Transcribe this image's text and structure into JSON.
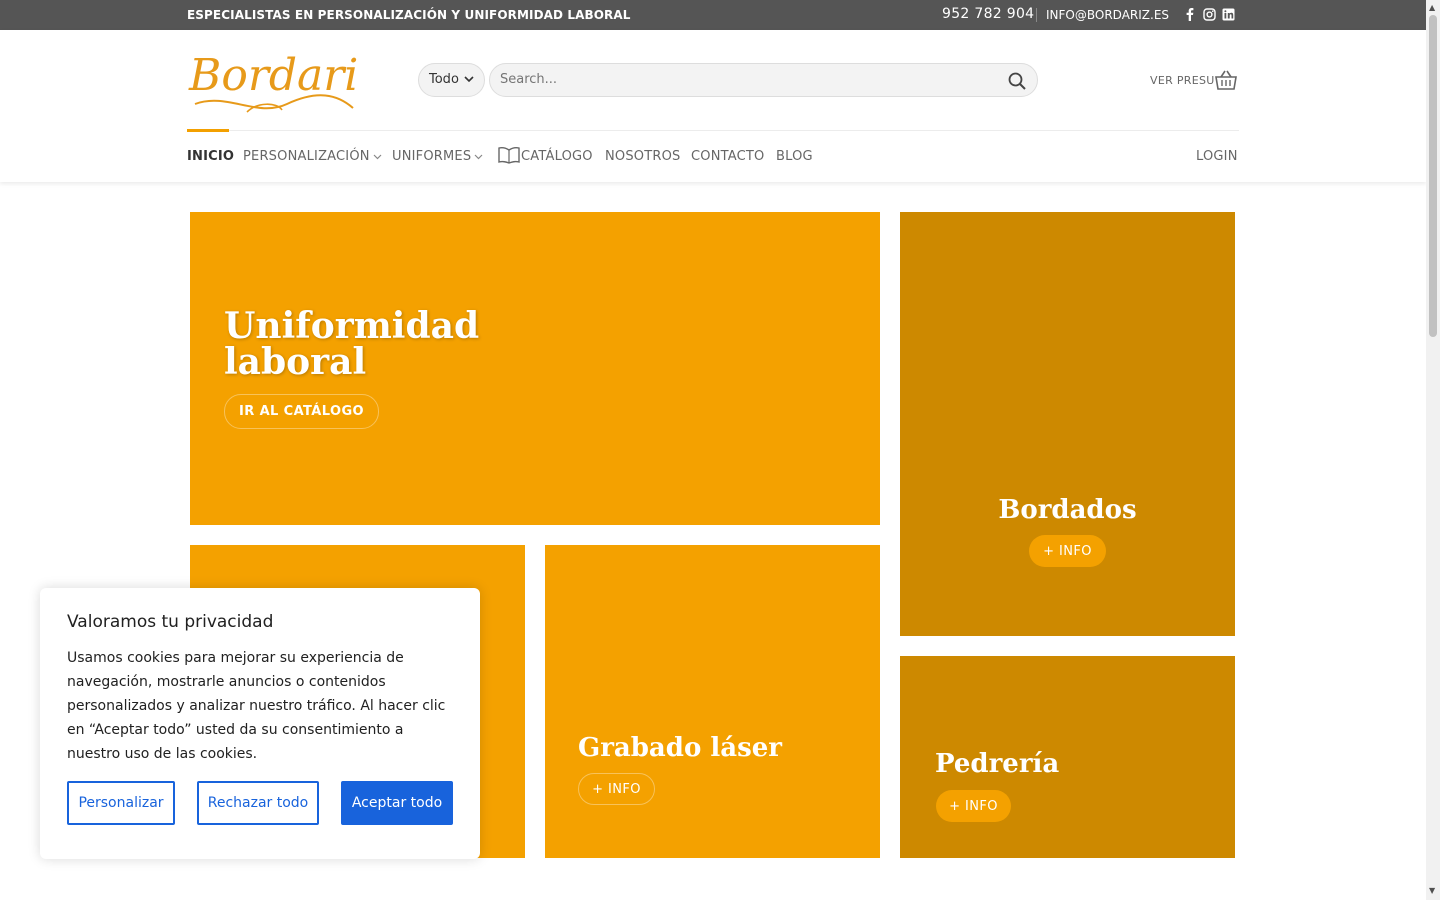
{
  "topbar": {
    "tagline": "ESPECIALISTAS EN PERSONALIZACIÓN Y UNIFORMIDAD LABORAL",
    "phone": "952 782 904",
    "email": "INFO@BORDARIZ.ES",
    "social": [
      "facebook-icon",
      "instagram-icon",
      "linkedin-icon"
    ]
  },
  "header": {
    "logo_text": "Bordariz",
    "category_select": "Todo",
    "search_placeholder": "Search...",
    "cart_label": "VER PRESU"
  },
  "nav": {
    "items": [
      {
        "label": "INICIO",
        "active": true
      },
      {
        "label": "PERSONALIZACIÓN",
        "dropdown": true
      },
      {
        "label": "UNIFORMES",
        "dropdown": true
      },
      {
        "label": "CATÁLOGO",
        "icon": "book-icon"
      },
      {
        "label": "NOSOTROS"
      },
      {
        "label": "CONTACTO"
      },
      {
        "label": "BLOG"
      }
    ],
    "login": "LOGIN"
  },
  "tiles": {
    "uniformidad": {
      "title_line1": "Uniformidad",
      "title_line2": "laboral",
      "button": "IR AL CATÁLOGO"
    },
    "bordados": {
      "title": "Bordados",
      "button": "+ INFO"
    },
    "grabado": {
      "title": "Grabado láser",
      "button": "+ INFO"
    },
    "pedreria": {
      "title": "Pedrería",
      "button": "+ INFO"
    }
  },
  "cookie": {
    "title": "Valoramos tu privacidad",
    "text": "Usamos cookies para mejorar su experiencia de navegación, mostrarle anuncios o contenidos personalizados y analizar nuestro tráfico. Al hacer clic en “Aceptar todo” usted da su consentimiento a nuestro uso de las cookies.",
    "customize": "Personalizar",
    "reject": "Rechazar todo",
    "accept": "Aceptar todo"
  },
  "colors": {
    "brand": "#f4a100",
    "brand_dark": "#cd8900",
    "cookie_blue": "#1863dc",
    "topbar": "#555555"
  }
}
